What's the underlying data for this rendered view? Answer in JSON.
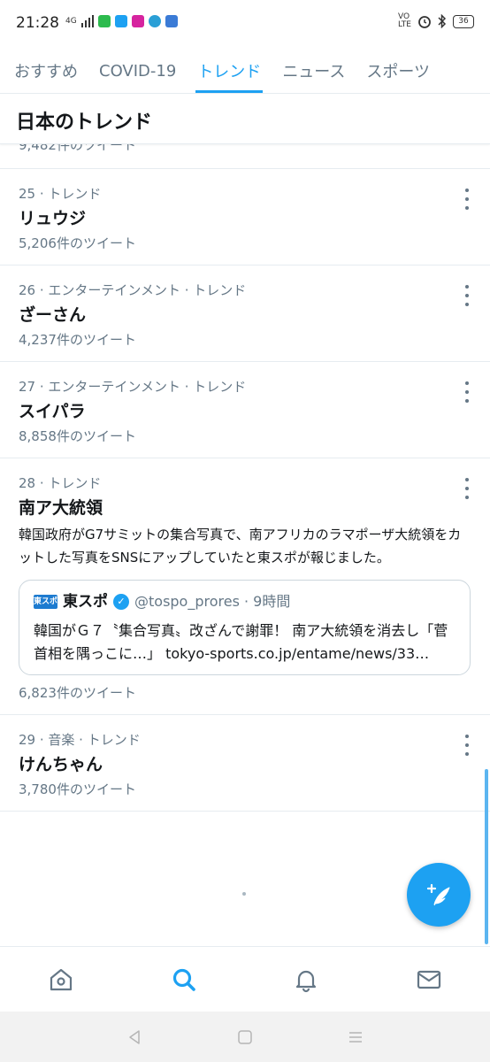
{
  "status_bar": {
    "time": "21:28",
    "network": "4G",
    "volte": "VO LTE",
    "battery": "36"
  },
  "tabs": [
    {
      "label": "おすすめ",
      "active": false
    },
    {
      "label": "COVID-19",
      "active": false
    },
    {
      "label": "トレンド",
      "active": true
    },
    {
      "label": "ニュース",
      "active": false
    },
    {
      "label": "スポーツ",
      "active": false
    }
  ],
  "section": {
    "title": "日本のトレンド"
  },
  "partial_row": {
    "text": "9,482件のツイート"
  },
  "trends": [
    {
      "meta": "25 · トレンド",
      "name": "リュウジ",
      "count": "5,206件のツイート"
    },
    {
      "meta": "26 · エンターテインメント · トレンド",
      "name": "ざーさん",
      "count": "4,237件のツイート"
    },
    {
      "meta": "27 · エンターテインメント · トレンド",
      "name": "スイパラ",
      "count": "8,858件のツイート"
    },
    {
      "meta": "28 · トレンド",
      "name": "南ア大統領",
      "description": "韓国政府がG7サミットの集合写真で、南アフリカのラマポーザ大統領をカットした写真をSNSにアップしていたと東スポが報じました。",
      "quote": {
        "logo": "東スポ",
        "name": "東スポ",
        "handle": "@tospo_prores · 9時間",
        "text": "韓国がＧ７〝集合写真〟改ざんで謝罪！ 南ア大統領を消去し「菅首相を隅っこに…」 tokyo-sports.co.jp/entame/news/33…"
      },
      "count": "6,823件のツイート"
    },
    {
      "meta": "29 · 音楽 · トレンド",
      "name": "けんちゃん",
      "count": "3,780件のツイート"
    }
  ],
  "colors": {
    "accent": "#1da1f2",
    "secondary_text": "#657786",
    "border": "#e6ecf0"
  },
  "icons": {
    "fab": "compose-tweet-icon",
    "nav": [
      "home-icon",
      "search-icon",
      "notifications-icon",
      "messages-icon"
    ],
    "system": [
      "back-icon",
      "home-circle-icon",
      "menu-icon"
    ]
  }
}
